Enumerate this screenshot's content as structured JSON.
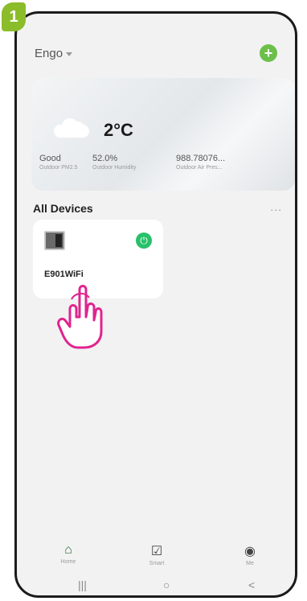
{
  "step_badge": "1",
  "header": {
    "home_name": "Engo",
    "add_label": "+"
  },
  "weather": {
    "temperature": "2°C",
    "metrics": [
      {
        "value": "Good",
        "label": "Outdoor PM2.5"
      },
      {
        "value": "52.0%",
        "label": "Outdoor Humidity"
      },
      {
        "value": "988.78076...",
        "label": "Outdoor Air Pres..."
      }
    ]
  },
  "devices": {
    "section_title": "All Devices",
    "more_label": "...",
    "items": [
      {
        "name": "E901WiFi",
        "power_icon": "⏻"
      }
    ]
  },
  "tabs": [
    {
      "label": "Home",
      "icon": "home-icon"
    },
    {
      "label": "Smart",
      "icon": "smart-icon"
    },
    {
      "label": "Me",
      "icon": "user-icon"
    }
  ],
  "nav": {
    "recent": "|||",
    "home": "○",
    "back": "<"
  },
  "colors": {
    "accent_green": "#27c16b",
    "badge_green": "#8bbc2a",
    "add_green": "#6cc04a",
    "hand_pink": "#e0248f"
  }
}
